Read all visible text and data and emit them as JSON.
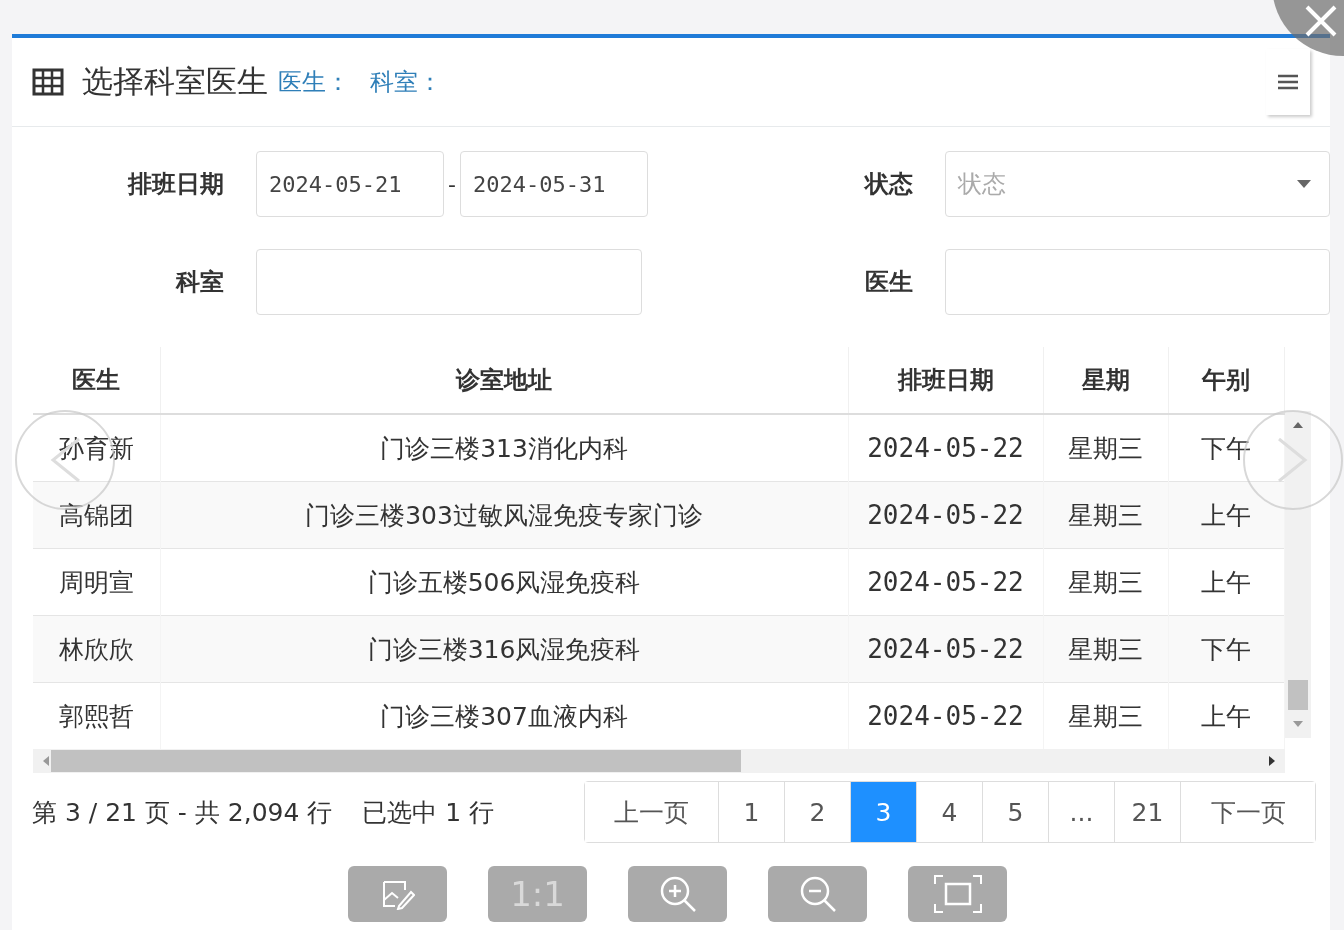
{
  "panel": {
    "title": "选择科室医生",
    "doctor_label": "医生：",
    "department_label": "科室："
  },
  "filters": {
    "date_label": "排班日期",
    "date_from": "2024-05-21",
    "date_separator": "-",
    "date_to": "2024-05-31",
    "status_label": "状态",
    "status_placeholder": "状态",
    "department_label": "科室",
    "doctor_label": "医生"
  },
  "table": {
    "columns": [
      "医生",
      "诊室地址",
      "排班日期",
      "星期",
      "午别"
    ],
    "rows": [
      [
        "孙育新",
        "门诊三楼313消化内科",
        "2024-05-22",
        "星期三",
        "下午"
      ],
      [
        "高锦团",
        "门诊三楼303过敏风湿免疫专家门诊",
        "2024-05-22",
        "星期三",
        "上午"
      ],
      [
        "周明宣",
        "门诊五楼506风湿免疫科",
        "2024-05-22",
        "星期三",
        "上午"
      ],
      [
        "林欣欣",
        "门诊三楼316风湿免疫科",
        "2024-05-22",
        "星期三",
        "下午"
      ],
      [
        "郭熙哲",
        "门诊三楼307血液内科",
        "2024-05-22",
        "星期三",
        "上午"
      ]
    ]
  },
  "pagination": {
    "summary": "第 3 / 21 页 - 共 2,094 行",
    "selected_info": "已选中 1 行",
    "prev": "上一页",
    "pages": [
      {
        "label": "1",
        "selected": false
      },
      {
        "label": "2",
        "selected": false
      },
      {
        "label": "3",
        "selected": true
      },
      {
        "label": "4",
        "selected": false
      },
      {
        "label": "5",
        "selected": false
      },
      {
        "label": "...",
        "selected": false
      },
      {
        "label": "21",
        "selected": false
      }
    ],
    "next": "下一页"
  },
  "viewer": {
    "toolbar": [
      {
        "kind": "edit"
      },
      {
        "kind": "actual_size",
        "label": "1:1"
      },
      {
        "kind": "zoom_in"
      },
      {
        "kind": "zoom_out"
      },
      {
        "kind": "fullscreen"
      }
    ]
  }
}
